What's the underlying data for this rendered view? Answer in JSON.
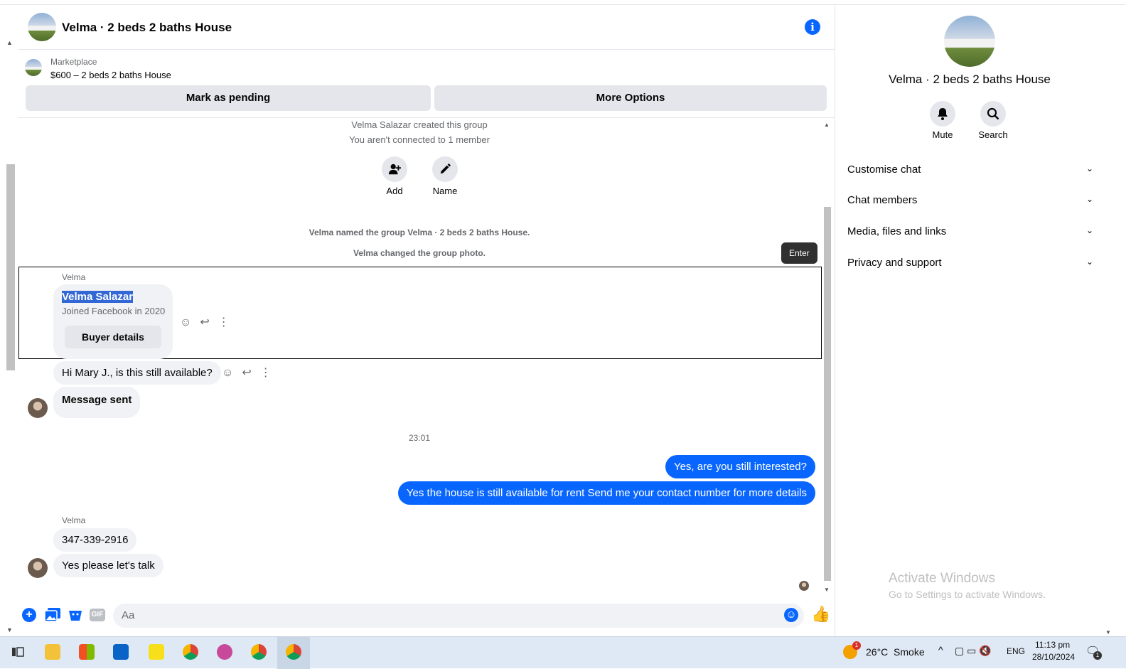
{
  "header": {
    "title": "Velma · 2 beds 2 baths House",
    "info_icon": "info-icon"
  },
  "marketplace": {
    "label": "Marketplace",
    "listing": "$600 – 2 beds 2 baths House",
    "mark_pending": "Mark as pending",
    "more_options": "More Options"
  },
  "system": {
    "created": "Velma Salazar created this group",
    "not_connected": "You aren't connected to 1 member",
    "add_label": "Add",
    "name_label": "Name",
    "named_group": "Velma named the group Velma · 2 beds 2 baths House.",
    "changed_photo": "Velma changed the group photo.",
    "tooltip": "Enter"
  },
  "messages": {
    "sender1": "Velma",
    "card_name": "Velma Salazar",
    "card_joined": "Joined Facebook in 2020",
    "card_button": "Buyer details",
    "msg1": "Hi Mary J., is this still available?",
    "msg2": "Message sent",
    "timestamp": "23:01",
    "out1": "Yes, are you still interested?",
    "out2": "Yes the house is still available for rent Send me your contact number for more details",
    "sender2": "Velma",
    "msg3": "347-339-2916",
    "msg4": "Yes please let's talk"
  },
  "composer": {
    "placeholder": "Aa"
  },
  "sidebar": {
    "title": "Velma · 2 beds 2 baths House",
    "mute": "Mute",
    "search": "Search",
    "rows": [
      "Customise chat",
      "Chat members",
      "Media, files and links",
      "Privacy and support"
    ]
  },
  "watermark": {
    "line1": "Activate Windows",
    "line2": "Go to Settings to activate Windows."
  },
  "taskbar": {
    "weather": "26°C  Smoke",
    "weather_badge": "1",
    "lang": "ENG",
    "time": "11:13 pm",
    "date": "28/10/2024",
    "notif_count": "1"
  },
  "colors": {
    "accent": "#0866ff",
    "bubble_gray": "#f0f2f5",
    "button_gray": "#e4e6eb"
  }
}
